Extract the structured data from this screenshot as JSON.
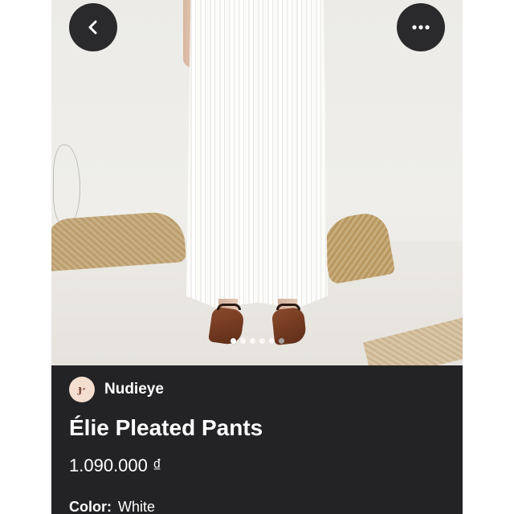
{
  "navigation": {
    "back_icon": "chevron-left-icon",
    "more_icon": "more-horizontal-icon"
  },
  "gallery": {
    "image_count": 6,
    "active_index": 0
  },
  "product": {
    "brand_logo_text": "ɟ·",
    "brand_name": "Nudieye",
    "title": "Élie Pleated Pants",
    "price": "1.090.000 ₫",
    "color_label": "Color:",
    "color_value": "White"
  },
  "colors": {
    "panel_background": "#232325",
    "button_background": "#2a2a2c",
    "text": "#ffffff",
    "brand_logo_background": "#f4ded0"
  }
}
